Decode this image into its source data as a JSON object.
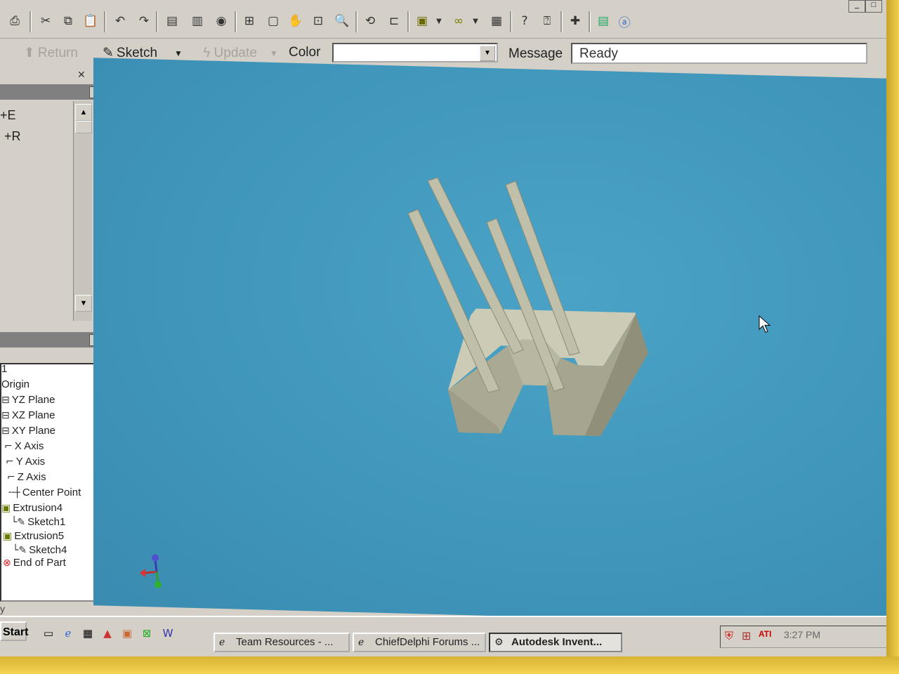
{
  "toolbar2": {
    "return_label": "Return",
    "sketch_label": "Sketch",
    "update_label": "Update",
    "color_label": "Color",
    "color_value": "",
    "message_label": "Message",
    "message_value": "Ready"
  },
  "top_panel": {
    "items": [
      "+E",
      "+R"
    ]
  },
  "browser": {
    "root": "1",
    "items": [
      {
        "label": "Origin",
        "icon": "folder-icon"
      },
      {
        "label": "YZ Plane",
        "icon": "plane-icon"
      },
      {
        "label": "XZ Plane",
        "icon": "plane-icon"
      },
      {
        "label": "XY Plane",
        "icon": "plane-icon"
      },
      {
        "label": "X Axis",
        "icon": "axis-icon"
      },
      {
        "label": "Y Axis",
        "icon": "axis-icon"
      },
      {
        "label": "Z Axis",
        "icon": "axis-icon"
      },
      {
        "label": "Center Point",
        "icon": "point-icon"
      },
      {
        "label": "Extrusion4",
        "icon": "extrusion-icon"
      },
      {
        "label": "Sketch1",
        "icon": "sketch-icon"
      },
      {
        "label": "Extrusion5",
        "icon": "extrusion-icon"
      },
      {
        "label": "Sketch4",
        "icon": "sketch-icon"
      },
      {
        "label": "End of Part",
        "icon": "end-of-part-icon"
      }
    ],
    "status_fragment": "y"
  },
  "taskbar": {
    "start_label": "Start",
    "tasks": [
      {
        "label": "Team Resources - ...",
        "active": false
      },
      {
        "label": "ChiefDelphi Forums ...",
        "active": false
      },
      {
        "label": "Autodesk Invent...",
        "active": true
      }
    ],
    "clock": "3:27 PM"
  },
  "colors": {
    "viewport_bg": "#3f95ba",
    "part_face": "#c8c8b4",
    "part_shadow": "#9d9d88",
    "window_chrome": "#d4d0c8"
  }
}
